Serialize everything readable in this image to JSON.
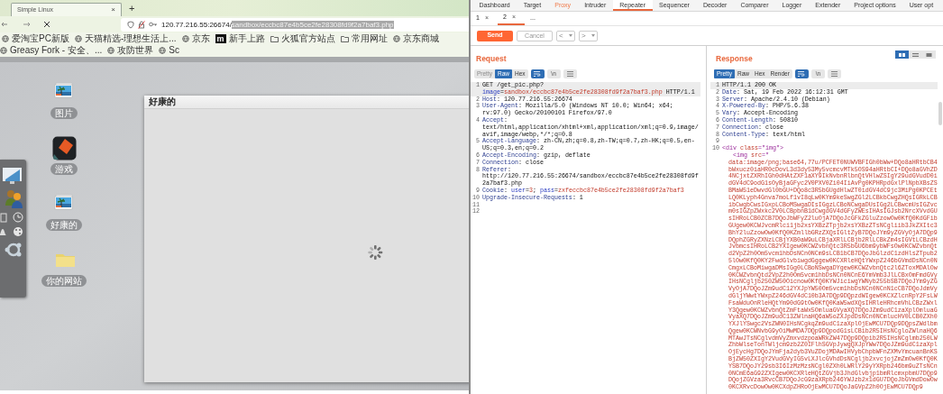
{
  "browser": {
    "tab": {
      "title": "Simple Linux",
      "close": "×"
    },
    "new_tab": "+",
    "url": {
      "host": "120.77.216.55:26674/",
      "path": "sandbox/eccbc87e4b5ce2fe28308fd9f2a7baf3.php",
      "path_selected": true
    },
    "bookmarks": [
      {
        "kind": "globe",
        "label": "爱淘宝PC新版"
      },
      {
        "kind": "globe",
        "label": "天猫精选-理想生活上..."
      },
      {
        "kind": "globe",
        "label": "京东"
      },
      {
        "kind": "badge",
        "badge": "m",
        "label": "新手上路"
      },
      {
        "kind": "folder",
        "label": "火狐官方站点"
      },
      {
        "kind": "folder",
        "label": "常用网址"
      },
      {
        "kind": "globe",
        "label": "京东商城"
      },
      {
        "kind": "globe",
        "label": "Greasy Fork - 安全、..."
      },
      {
        "kind": "globe",
        "label": "攻防世界"
      },
      {
        "kind": "globe",
        "label": "Sc"
      }
    ]
  },
  "desktop": {
    "icons": [
      {
        "kind": "picture",
        "label": "图片"
      },
      {
        "kind": "game",
        "label": "游戏"
      },
      {
        "kind": "picture",
        "label": "好康的"
      },
      {
        "kind": "folder",
        "label": "你的网站"
      }
    ],
    "dock": [
      {
        "kind": "monitor"
      },
      {
        "kind": "users"
      },
      {
        "kind": "calendar"
      },
      {
        "kind": "clock"
      },
      {
        "kind": "bell"
      },
      {
        "kind": "palette"
      },
      {
        "kind": "ubuntu"
      }
    ],
    "window": {
      "title": "好康的",
      "loading": true
    }
  },
  "burp": {
    "tabs": [
      {
        "label": "Dashboard",
        "selected": false,
        "highlighted": false
      },
      {
        "label": "Target",
        "selected": false,
        "highlighted": false
      },
      {
        "label": "Proxy",
        "selected": false,
        "highlighted": true
      },
      {
        "label": "Intruder",
        "selected": false,
        "highlighted": false
      },
      {
        "label": "Repeater",
        "selected": true,
        "highlighted": false
      },
      {
        "label": "Sequencer",
        "selected": false,
        "highlighted": false
      },
      {
        "label": "Decoder",
        "selected": false,
        "highlighted": false
      },
      {
        "label": "Comparer",
        "selected": false,
        "highlighted": false
      },
      {
        "label": "Logger",
        "selected": false,
        "highlighted": false
      },
      {
        "label": "Extender",
        "selected": false,
        "highlighted": false
      },
      {
        "label": "Project options",
        "selected": false,
        "highlighted": false
      },
      {
        "label": "User opt",
        "selected": false,
        "highlighted": false
      }
    ],
    "repeater_tabs": [
      {
        "label": "1",
        "close": "×",
        "selected": false
      },
      {
        "label": "2",
        "close": "×",
        "selected": true
      },
      {
        "label": "...",
        "selected": false
      }
    ],
    "buttons": {
      "send": "Send",
      "cancel": "Cancel",
      "prev": "<",
      "next": ">"
    },
    "layout_modes": [
      {
        "kind": "columns",
        "selected": true
      },
      {
        "kind": "rows",
        "selected": false
      },
      {
        "kind": "single",
        "selected": false
      }
    ],
    "request": {
      "title": "Request",
      "views": [
        {
          "label": "Pretty",
          "selected": false,
          "disabled": true
        },
        {
          "label": "Raw",
          "selected": true,
          "disabled": false
        },
        {
          "label": "Hex",
          "selected": false,
          "disabled": false
        }
      ],
      "wrap_on": true,
      "newline_label": "\\n",
      "lines": [
        {
          "n": "1",
          "highlighted": true,
          "segments": [
            {
              "kind": "plain",
              "text": "GET /get_pic.php?"
            },
            {
              "kind": "param",
              "text": "image"
            },
            {
              "kind": "plain",
              "text": "="
            },
            {
              "kind": "param_value",
              "text": "sandbox/eccbc87e4b5ce2fe28308fd9f2a7baf3.php"
            },
            {
              "kind": "plain",
              "text": " HTTP/1.1"
            }
          ]
        },
        {
          "n": "2",
          "highlighted": false,
          "segments": [
            {
              "kind": "name",
              "text": "Host"
            },
            {
              "kind": "plain",
              "text": ": 120.77.216.55:26674"
            }
          ]
        },
        {
          "n": "3",
          "highlighted": false,
          "segments": [
            {
              "kind": "name",
              "text": "User-Agent"
            },
            {
              "kind": "plain",
              "text": ": Mozilla/5.0 (Windows NT 10.0; Win64; x64; rv:97.0) Gecko/20100101 Firefox/97.0"
            }
          ]
        },
        {
          "n": "4",
          "highlighted": false,
          "segments": [
            {
              "kind": "name",
              "text": "Accept"
            },
            {
              "kind": "plain",
              "text": ": text/html,application/xhtml+xml,application/xml;q=0.9,image/avif,image/webp,*/*;q=0.8"
            }
          ]
        },
        {
          "n": "5",
          "highlighted": false,
          "segments": [
            {
              "kind": "name",
              "text": "Accept-Language"
            },
            {
              "kind": "plain",
              "text": ": zh-CN,zh;q=0.8,zh-TW;q=0.7,zh-HK;q=0.5,en-US;q=0.3,en;q=0.2"
            }
          ]
        },
        {
          "n": "6",
          "highlighted": false,
          "segments": [
            {
              "kind": "name",
              "text": "Accept-Encoding"
            },
            {
              "kind": "plain",
              "text": ": gzip, deflate"
            }
          ]
        },
        {
          "n": "7",
          "highlighted": false,
          "segments": [
            {
              "kind": "name",
              "text": "Connection"
            },
            {
              "kind": "plain",
              "text": ": close"
            }
          ]
        },
        {
          "n": "8",
          "highlighted": false,
          "segments": [
            {
              "kind": "name",
              "text": "Referer"
            },
            {
              "kind": "plain",
              "text": ": http://120.77.216.55:26674/sandbox/eccbc87e4b5ce2fe28308fd9f2a7baf3.php"
            }
          ]
        },
        {
          "n": "9",
          "highlighted": false,
          "segments": [
            {
              "kind": "name",
              "text": "Cookie"
            },
            {
              "kind": "plain",
              "text": ": "
            },
            {
              "kind": "param",
              "text": "user"
            },
            {
              "kind": "plain",
              "text": "="
            },
            {
              "kind": "param_value",
              "text": "3"
            },
            {
              "kind": "plain",
              "text": "; "
            },
            {
              "kind": "param",
              "text": "pass"
            },
            {
              "kind": "plain",
              "text": "="
            },
            {
              "kind": "param_value",
              "text": "zxfeccbc87e4b5ce2fe28308fd9f2a7baf3"
            }
          ]
        },
        {
          "n": "10",
          "highlighted": false,
          "segments": [
            {
              "kind": "name",
              "text": "Upgrade-Insecure-Requests"
            },
            {
              "kind": "plain",
              "text": ": 1"
            }
          ]
        },
        {
          "n": "11",
          "highlighted": false
        },
        {
          "n": "12",
          "highlighted": false
        }
      ]
    },
    "response": {
      "title": "Response",
      "views": [
        {
          "label": "Pretty",
          "selected": true,
          "disabled": false
        },
        {
          "label": "Raw",
          "selected": false,
          "disabled": false
        },
        {
          "label": "Hex",
          "selected": false,
          "disabled": false
        },
        {
          "label": "Render",
          "selected": false,
          "disabled": false
        }
      ],
      "wrap_on": true,
      "newline_label": "\\n",
      "lines": [
        {
          "n": "1",
          "highlighted": true,
          "segments": [
            {
              "kind": "plain",
              "text": "HTTP/1.1 200 OK"
            }
          ]
        },
        {
          "n": "2",
          "highlighted": false,
          "segments": [
            {
              "kind": "name",
              "text": "Date"
            },
            {
              "kind": "plain",
              "text": ": Sat, 19 Feb 2022 16:12:31 GMT"
            }
          ]
        },
        {
          "n": "3",
          "highlighted": false,
          "segments": [
            {
              "kind": "name",
              "text": "Server"
            },
            {
              "kind": "plain",
              "text": ": Apache/2.4.10 (Debian)"
            }
          ]
        },
        {
          "n": "4",
          "highlighted": false,
          "segments": [
            {
              "kind": "name",
              "text": "X-Powered-By"
            },
            {
              "kind": "plain",
              "text": ": PHP/5.6.38"
            }
          ]
        },
        {
          "n": "5",
          "highlighted": false,
          "segments": [
            {
              "kind": "name",
              "text": "Vary"
            },
            {
              "kind": "plain",
              "text": ": Accept-Encoding"
            }
          ]
        },
        {
          "n": "6",
          "highlighted": false,
          "segments": [
            {
              "kind": "name",
              "text": "Content-Length"
            },
            {
              "kind": "plain",
              "text": ": 50810"
            }
          ]
        },
        {
          "n": "7",
          "highlighted": false,
          "segments": [
            {
              "kind": "name",
              "text": "Connection"
            },
            {
              "kind": "plain",
              "text": ": close"
            }
          ]
        },
        {
          "n": "8",
          "highlighted": false,
          "segments": [
            {
              "kind": "name",
              "text": "Content-Type"
            },
            {
              "kind": "plain",
              "text": ": text/html"
            }
          ]
        },
        {
          "n": "9",
          "highlighted": false
        },
        {
          "n": "10",
          "highlighted": false,
          "segments": [
            {
              "kind": "tag",
              "text": "<div "
            },
            {
              "kind": "attr",
              "text": "class"
            },
            {
              "kind": "tag",
              "text": "=\"img\">"
            }
          ],
          "body": [
            {
              "segments": [
                {
                  "kind": "tag",
                  "text": "<img "
                },
                {
                  "kind": "attr",
                  "text": "src"
                },
                {
                  "kind": "tag",
                  "text": "=\""
                }
              ]
            },
            {
              "segments": [
                {
                  "kind": "attr",
                  "text": "data:image/png;base64,77u/PCFET0NUWVBFIGh0bWw+DQo8aHRtbCB4bWxucz0iaHR0cDovL3d3dy53My5vcmcvMTk5OS94aHRtbCI+DQo8aGVhZD4NCjxtZXRhIGh0dHAtZXF1aXY9IkNvbnRlbnQtVHlwZSIgY29udGVudD0idGV4dC9odG1sOyBjaGFyc2V0PXV0Zi04IiAvPg0KPHRpdGxlPlNpbXBsZSBMaW51eDwvdGl0bGU+DQo8c3R5bGUgdHlwZT0idGV4dC9jc3MiPg0KPCEtLQ0KLyph4Gnva7moLf1vI8qLw0KYm9keSwgZGl2LCBkbCwgZHQsIGRkLCBibCwgbCwsIGxpLCBoMSwgaDIsIGgzLCBoNCwgaDUsIGg2LCBwcmUsIGZvcm0sIGZpZWxkc2V0LCBpbnB1dCwgdGV4dGFyZWEsIHAsIGJsb2NrcXVvdGUsIHRoLCB0ZCB7DQoJbWFyZ2luOjA7DQoJcGFkZGluZzowOw0KfQ0KdGFibGUgew0KCWJvcmRlci1jb2xsYXBzZTpjb2xsYXBzZTsNCgliib3JkZXItc3BhY2luZzowOw0KfQ0KZmllbGRzZXQsIGltZyB7DQoJYm9yZGVyOjA7DQp9DQphZGRyZXNzLCBjYXB0aW9uLCBjaXRlLCBjb2RlLCBkZm4sIGVtLCBzdHJvbmcsIHRoLCB2YXIgew0KCWZvbnQtc3R5bGU6bm9ybWFsOw0KCWZvbnQtd2VpZ2h0Om5vcm1hbDsNCn0NCm9sLCB1bCB7DQoJbGlzdC1zdHlsZTpub25lOw0KfQ0KY2FwdGlvbiwgdGggew0KCXRleHQtYWxpZ246bGVmdDsNCn0NCmgxLCBoMiwgaDMsIGg0LCBoNSwgaDYgew0KCWZvbnQtc2l6ZToxMDAlOw0KCWZvbnQtd2VpZ2h0Om5vcm1hbDsNCn0NCnE6YmVmb3JlLCBxOmFmdGVyIHsNCgljb250ZW50Oicnow0KfQ0KYWJiciwgYWNyb255bSB7DQoJYm9yZGVyOjA7DQoJZm9udC12YXJpYW50Om5vcm1hbDsNCn0NCnN1cCB7DQoJdmVydGljYWwtYWxpZ246dGV4dC10b3A7DQp9DQpzdWIgew0KCXZlcnRpY2FsLWFsaWduOnRleHQtYm90dG9tOw0KfQ0KaW5wdXQsIHRleHRhcmVhLCBzZWxlY3Qgew0KCWZvbnQtZmFtaWx5OmluaGVyaXQ7DQoJZm9udC1zaXplOmluaGVyaXQ7DQoJZm9udC13ZWlnaHQ6aW5oZXJpdDsNCn0NCmlucHV0LCB0ZXh0YXJlYSwgc2VsZWN0IHsNCgkqZm9udC1zaXplOjEwMCU7DQp9DQpsZWdlbmQgew0KCWNvbG9yOiMwMDA7DQp9DQpodG1sLCBib2R5IHsNCgloZWlnaHQ6MTAwJTsNCglvdmVyZmxvdzpoaWRkZW47DQp9DQpib2R5IHsNCglmb250LWZhbWlseTonTWljcm9zb2Z0IFlhSGVpJywgQXJpYWw7DQoJZm9udC1zaXplOjEycHg7DQoJYmFja2dyb3VuZDojMDAwIHVybChpbWFnZXMvYmcuanBnKSBjZW50ZXIgY2VudGVyIG5vLXJlcGVhdDsNCgljb2xvcjojZmZmOw0KfQ0KYSB7DQoJY29sb3I6IzMzMzsNCgl0ZXh0LWRlY29yYXRpb246bm9uZTsNCn0NCmE6aG92ZXIgew0KCXRleHQtZGVjb3JhdGlvbjp1bmRlcmxpbmU7DQp9DQojZGVza3RvcCB7DQoJcG9zaXRpb246YWJzb2x1dGU7DQoJbGVmdDowOw0KCXRvcDowOw0KCXdpZHRoOjEwMCU7DQoJaGVpZ2h0OjEwMCU7DQp9"
                }
              ]
            }
          ]
        }
      ]
    }
  }
}
